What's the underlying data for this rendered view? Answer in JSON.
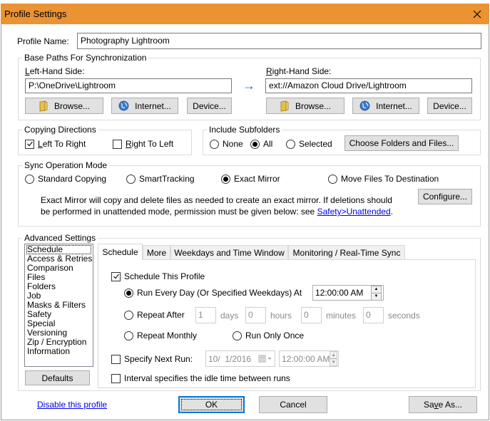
{
  "window": {
    "title": "Profile Settings",
    "accent_color": "#eb9332"
  },
  "profile_name": {
    "label": "Profile Name:",
    "value": "Photography Lightroom"
  },
  "base_paths": {
    "title": "Base Paths For Synchronization",
    "left": {
      "label_accel": "L",
      "label_rest": "eft-Hand Side:",
      "value": "P:\\OneDrive\\Lightroom",
      "browse_label": "Browse...",
      "internet_label": "Internet...",
      "device_label": "Device..."
    },
    "direction_arrow": "→",
    "right": {
      "label_accel": "R",
      "label_rest": "ight-Hand Side:",
      "value": "ext://Amazon Cloud Drive/Lightroom",
      "browse_label": "Browse...",
      "internet_label": "Internet...",
      "device_label": "Device..."
    }
  },
  "copying_directions": {
    "title": "Copying Directions",
    "left_to_right": {
      "accel": "L",
      "rest": "eft To Right",
      "checked": true
    },
    "right_to_left": {
      "accel": "R",
      "rest": "ight To Left",
      "checked": false
    }
  },
  "include_subfolders": {
    "title": "Include Subfolders",
    "options": [
      {
        "label": "None",
        "selected": false
      },
      {
        "label": "All",
        "selected": true
      },
      {
        "label": "Selected",
        "selected": false
      }
    ],
    "choose_button": "Choose Folders and Files..."
  },
  "sync_mode": {
    "title": "Sync Operation Mode",
    "options": [
      {
        "label": "Standard Copying",
        "selected": false
      },
      {
        "label": "SmartTracking",
        "selected": false
      },
      {
        "label": "Exact Mirror",
        "selected": true
      },
      {
        "label": "Move Files To Destination",
        "selected": false
      }
    ],
    "description_line1": "Exact Mirror will copy and delete files as needed to create an exact mirror. If deletions should",
    "description_line2": "be performed in unattended mode, permission must be given below: see ",
    "description_link": "Safety>Unattended",
    "description_end": ".",
    "configure_button": "Configure..."
  },
  "advanced": {
    "title": "Advanced Settings",
    "categories": [
      "Schedule",
      "Access & Retries",
      "Comparison",
      "Files",
      "Folders",
      "Job",
      "Masks & Filters",
      "Safety",
      "Special",
      "Versioning",
      "Zip / Encryption",
      "Information"
    ],
    "selected_category": "Schedule",
    "defaults_button": "Defaults",
    "tabs": [
      "Schedule",
      "More",
      "Weekdays and Time Window",
      "Monitoring / Real-Time Sync"
    ],
    "active_tab": "Schedule",
    "schedule": {
      "schedule_this_profile": {
        "label": "Schedule This Profile",
        "checked": true
      },
      "run_every_day": {
        "label": "Run Every Day (Or Specified Weekdays) At",
        "selected": true,
        "time": "12:00:00 AM"
      },
      "repeat_after": {
        "label": "Repeat After",
        "selected": false,
        "days": "1",
        "days_label": "days",
        "hours": "0",
        "hours_label": "hours",
        "minutes": "0",
        "minutes_label": "minutes",
        "seconds": "0",
        "seconds_label": "seconds"
      },
      "repeat_monthly": {
        "label": "Repeat Monthly",
        "selected": false
      },
      "run_only_once": {
        "label": "Run Only Once",
        "selected": false
      },
      "specify_next_run": {
        "label": "Specify Next Run:",
        "checked": false,
        "date": "10/  1/2016",
        "time": "12:00:00 AM"
      },
      "interval_idle": {
        "label": "Interval specifies the idle time between runs",
        "checked": false
      }
    }
  },
  "footer": {
    "disable_link": "Disable this profile",
    "ok_button": "OK",
    "cancel_button": "Cancel",
    "save_as_pre": "Sa",
    "save_as_accel": "v",
    "save_as_post": "e As..."
  }
}
